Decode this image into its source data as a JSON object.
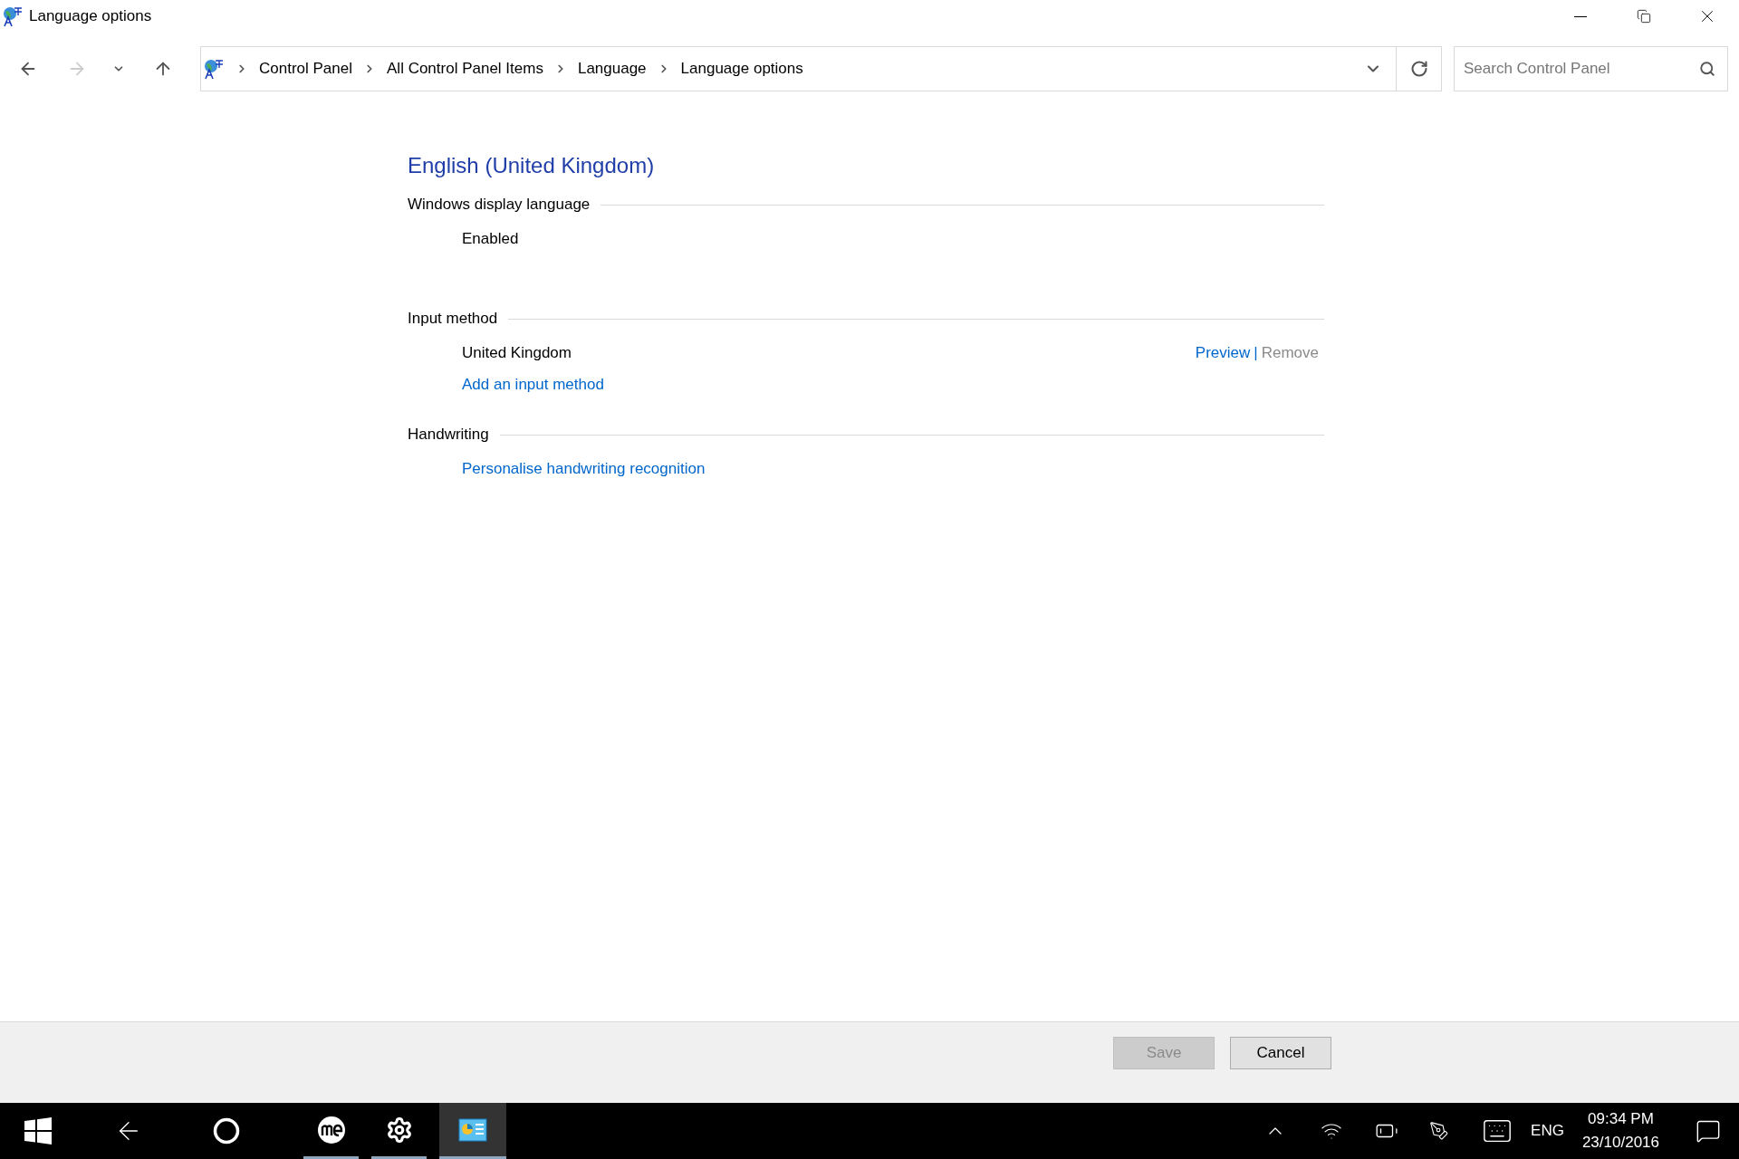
{
  "window": {
    "title": "Language options"
  },
  "navigation": {
    "back_disabled": false,
    "forward_disabled": true
  },
  "address_bar": {
    "breadcrumbs": [
      "Control Panel",
      "All Control Panel Items",
      "Language",
      "Language options"
    ]
  },
  "search": {
    "placeholder": "Search Control Panel"
  },
  "language": {
    "title": "English (United Kingdom)"
  },
  "sections": [
    {
      "heading": "Windows display language",
      "items": [
        {
          "kind": "text",
          "text": "Enabled"
        }
      ]
    },
    {
      "heading": "Input method",
      "items": [
        {
          "kind": "method",
          "text": "United Kingdom",
          "separator": "|",
          "actions": [
            {
              "label": "Preview",
              "disabled": false
            },
            {
              "label": "Remove",
              "disabled": true
            }
          ]
        },
        {
          "kind": "link",
          "text": "Add an input method"
        }
      ]
    },
    {
      "heading": "Handwriting",
      "items": [
        {
          "kind": "link",
          "text": "Personalise handwriting recognition"
        }
      ]
    }
  ],
  "buttons": [
    {
      "label": "Save",
      "disabled": true
    },
    {
      "label": "Cancel",
      "disabled": false
    }
  ],
  "taskbar": {
    "apps": [
      {
        "kind": "me",
        "running": true,
        "active": false
      },
      {
        "kind": "settings",
        "running": true,
        "active": false
      },
      {
        "kind": "control-panel",
        "running": true,
        "active": true
      }
    ],
    "tray": {
      "language": "ENG",
      "time": "09:34 PM",
      "date": "23/10/2016"
    }
  }
}
